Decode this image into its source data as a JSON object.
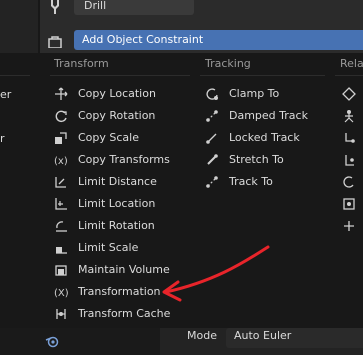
{
  "header": {
    "object_name": "Drill",
    "add_constraint_label": "Add Object Constraint"
  },
  "menu": {
    "columns": [
      {
        "title": "Transform"
      },
      {
        "title": "Tracking"
      },
      {
        "title": "Rela"
      }
    ],
    "transform_items": [
      {
        "label": "Copy Location",
        "icon": "copy-location-icon"
      },
      {
        "label": "Copy Rotation",
        "icon": "copy-rotation-icon"
      },
      {
        "label": "Copy Scale",
        "icon": "copy-scale-icon"
      },
      {
        "label": "Copy Transforms",
        "icon": "copy-transforms-icon"
      },
      {
        "label": "Limit Distance",
        "icon": "limit-distance-icon"
      },
      {
        "label": "Limit Location",
        "icon": "limit-location-icon"
      },
      {
        "label": "Limit Rotation",
        "icon": "limit-rotation-icon"
      },
      {
        "label": "Limit Scale",
        "icon": "limit-scale-icon"
      },
      {
        "label": "Maintain Volume",
        "icon": "maintain-volume-icon"
      },
      {
        "label": "Transformation",
        "icon": "transformation-icon"
      },
      {
        "label": "Transform Cache",
        "icon": "transform-cache-icon"
      }
    ],
    "tracking_items": [
      {
        "label": "Clamp To",
        "icon": "clamp-to-icon"
      },
      {
        "label": "Damped Track",
        "icon": "damped-track-icon"
      },
      {
        "label": "Locked Track",
        "icon": "locked-track-icon"
      },
      {
        "label": "Stretch To",
        "icon": "stretch-to-icon"
      },
      {
        "label": "Track To",
        "icon": "track-to-icon"
      }
    ],
    "left_cut": {
      "row1": "er",
      "row3": "r"
    }
  },
  "footer": {
    "mode_label": "Mode",
    "mode_value": "Auto Euler"
  },
  "annotation": {
    "color": "#e8242a"
  }
}
